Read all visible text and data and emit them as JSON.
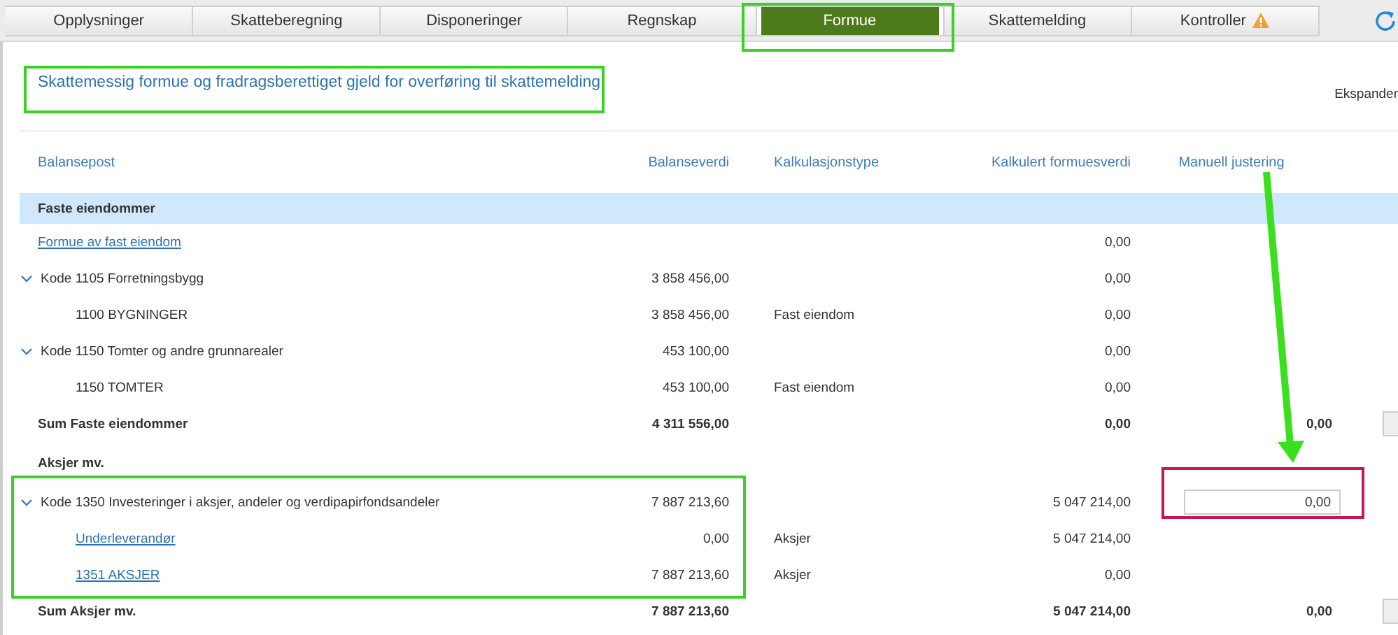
{
  "tabs": [
    {
      "label": "Opplysninger",
      "selected": false,
      "warning": false
    },
    {
      "label": "Skatteberegning",
      "selected": false,
      "warning": false
    },
    {
      "label": "Disponeringer",
      "selected": false,
      "warning": false
    },
    {
      "label": "Regnskap",
      "selected": false,
      "warning": false
    },
    {
      "label": "Formue",
      "selected": true,
      "warning": false
    },
    {
      "label": "Skattemelding",
      "selected": false,
      "warning": false
    },
    {
      "label": "Kontroller",
      "selected": false,
      "warning": true
    }
  ],
  "heading": "Skattemessig formue og fradragsberettiget gjeld for overføring til skattemelding",
  "expand_label": "Ekspander",
  "table": {
    "columns": [
      "Balansepost",
      "Balanseverdi",
      "Kalkulasjonstype",
      "Kalkulert formuesverdi",
      "Manuell justering"
    ],
    "rows": [
      {
        "kind": "section",
        "name": "Faste eiendommer"
      },
      {
        "kind": "link",
        "name": "Formue av fast eiendom",
        "formue": "0,00"
      },
      {
        "kind": "code",
        "name": "Kode 1105 Forretningsbygg",
        "expanded": true,
        "balance": "3 858 456,00",
        "formue": "0,00",
        "children": [
          {
            "kind": "item",
            "name": "1100 BYGNINGER",
            "balance": "3 858 456,00",
            "calc_type": "Fast eiendom",
            "formue": "0,00"
          }
        ]
      },
      {
        "kind": "code",
        "name": "Kode 1150 Tomter og andre grunnarealer",
        "expanded": true,
        "balance": "453 100,00",
        "formue": "0,00",
        "children": [
          {
            "kind": "item",
            "name": "1150 TOMTER",
            "balance": "453 100,00",
            "calc_type": "Fast eiendom",
            "formue": "0,00"
          }
        ]
      },
      {
        "kind": "sum",
        "name": "Sum Faste eiendommer",
        "balance": "4 311 556,00",
        "formue": "0,00",
        "manual": "0,00"
      },
      {
        "kind": "heading",
        "name": "Aksjer mv."
      },
      {
        "kind": "code",
        "name": "Kode 1350 Investeringer i aksjer, andeler og verdipapirfondsandeler",
        "expanded": true,
        "balance": "7 887 213,60",
        "formue": "5 047 214,00",
        "manual_input": "0,00",
        "children": [
          {
            "kind": "link",
            "name": "Underleverandør",
            "balance": "0,00",
            "calc_type": "Aksjer",
            "formue": "5 047 214,00"
          },
          {
            "kind": "link",
            "name": "1351 AKSJER",
            "balance": "7 887 213,60",
            "calc_type": "Aksjer",
            "formue": "0,00"
          }
        ]
      },
      {
        "kind": "sum",
        "name": "Sum Aksjer mv.",
        "balance": "7 887 213,60",
        "formue": "5 047 214,00",
        "manual": "0,00"
      }
    ]
  }
}
